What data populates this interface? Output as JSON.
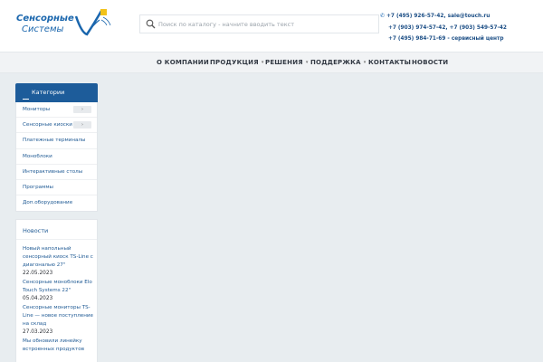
{
  "logo": {
    "line1": "Сенсорные",
    "line2": "Системы"
  },
  "search": {
    "placeholder": "Поиск по каталогу - начните вводить текст"
  },
  "contacts": [
    "+7 (495) 926-57-42, sale@touch.ru",
    "+7 (903) 974-57-42, +7 (903) 549-57-42",
    "+7 (495) 984-71-69 - сервисный центр"
  ],
  "nav": [
    {
      "label": "О КОМПАНИИ",
      "dropdown": false
    },
    {
      "label": "ПРОДУКЦИЯ",
      "dropdown": true
    },
    {
      "label": "РЕШЕНИЯ",
      "dropdown": true
    },
    {
      "label": "ПОДДЕРЖКА",
      "dropdown": true
    },
    {
      "label": "КОНТАКТЫ",
      "dropdown": false
    },
    {
      "label": "НОВОСТИ",
      "dropdown": false
    }
  ],
  "sidebar": {
    "title": "Категории",
    "items": [
      {
        "label": "Мониторы",
        "toggle": "›"
      },
      {
        "label": "Сенсорные киоски",
        "toggle": "›"
      },
      {
        "label": "Платежные терминалы"
      },
      {
        "label": "Моноблоки"
      },
      {
        "label": "Интерактивные столы"
      },
      {
        "label": "Программы"
      },
      {
        "label": "Доп.оборудование"
      }
    ]
  },
  "news": {
    "title": "Новости",
    "items": [
      {
        "text": "Новый напольный сенсорный киоск TS-Line с диагональю 27\"",
        "date": "22.05.2023"
      },
      {
        "text": "Сенсорные моноблоки Elo Touch Systems 22\"",
        "date": "05.04.2023"
      },
      {
        "text": "Сенсорные мониторы TS-Line — новое поступление на склад",
        "date": "27.03.2023"
      },
      {
        "text": "Мы обновили линейку встроенных продуктов",
        "date": ""
      }
    ]
  },
  "colors": {
    "brand": "#1d5c9a",
    "link": "#1f5a94",
    "background": "#e8edf0"
  }
}
